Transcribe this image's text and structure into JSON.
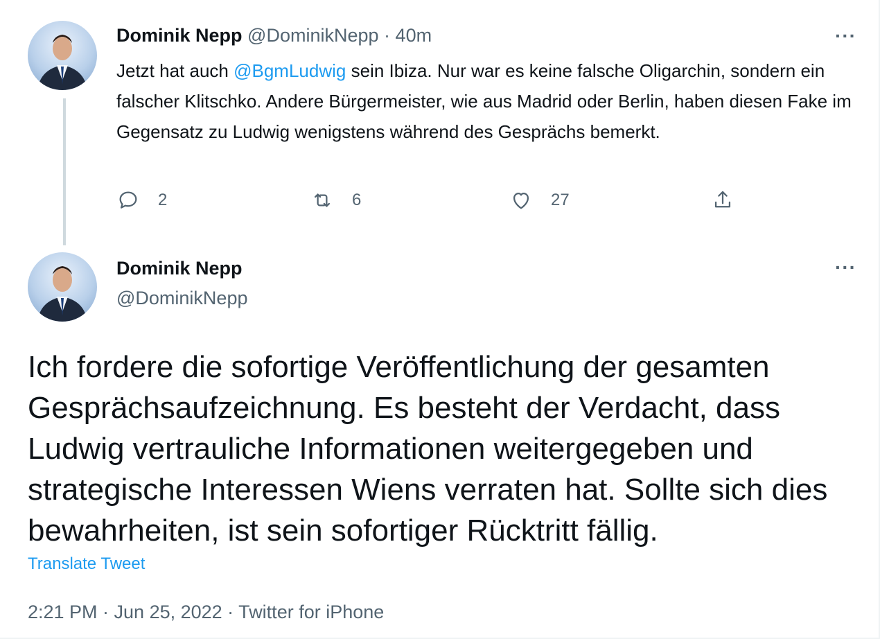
{
  "tweet1": {
    "author_name": "Dominik Nepp",
    "author_handle": "@DominikNepp",
    "separator": "·",
    "age": "40m",
    "more": "···",
    "text_before": "Jetzt hat auch ",
    "mention": "@BgmLudwig",
    "text_after": " sein Ibiza. Nur war es keine falsche Oligarchin, sondern ein falscher Klitschko. Andere Bürgermeister, wie aus Madrid oder Berlin, haben diesen Fake im Gegensatz zu Ludwig wenigstens während des Gesprächs bemerkt.",
    "replies": "2",
    "retweets": "6",
    "likes": "27"
  },
  "tweet2": {
    "author_name": "Dominik Nepp",
    "author_handle": "@DominikNepp",
    "more": "···",
    "text": "Ich fordere die sofortige Veröffentlichung der gesamten Gesprächsaufzeichnung. Es besteht der Verdacht, dass Ludwig  vertrauliche Informationen weitergegeben und strategische Interessen Wiens verraten hat. Sollte sich dies bewahrheiten, ist sein sofortiger Rücktritt fällig.",
    "translate_label": "Translate Tweet",
    "timestamp": "2:21 PM · Jun 25, 2022 · Twitter for iPhone"
  },
  "icons": {
    "reply": "reply-icon",
    "retweet": "retweet-icon",
    "like": "heart-icon",
    "share": "share-icon"
  },
  "colors": {
    "link": "#1d9bf0",
    "secondary_text": "#536471",
    "thread_line": "#cfd9de"
  }
}
